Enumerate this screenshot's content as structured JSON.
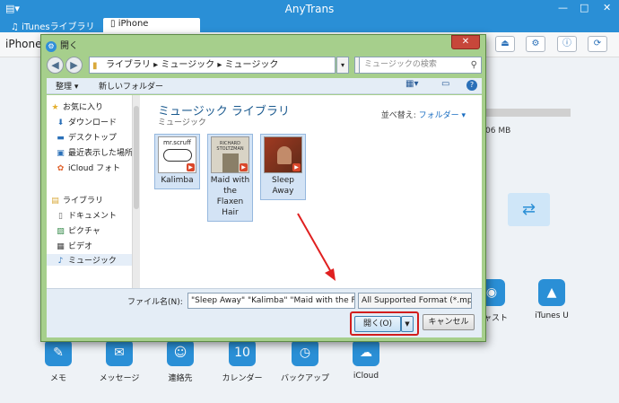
{
  "app": {
    "title": "AnyTrans",
    "menu_icon": "▤▾",
    "window_controls": [
      "—",
      "□",
      "✕"
    ],
    "tabs": [
      {
        "label": "iTunesライブラリ",
        "icon": "music-note-icon"
      },
      {
        "label": "iPhone",
        "icon": "phone-icon"
      }
    ],
    "device_name": "iPhone",
    "toolbar_icons": [
      "eject-icon",
      "gear-icon",
      "info-icon",
      "sync-icon"
    ],
    "storage_text": "06 MB",
    "apps_row1": [
      {
        "label": "キャスト",
        "icon": "podcast-icon"
      },
      {
        "label": "iTunes U",
        "icon": "graduation-cap-icon"
      }
    ],
    "apps_row2": [
      {
        "label": "メモ",
        "icon": "notes-icon"
      },
      {
        "label": "メッセージ",
        "icon": "message-icon"
      },
      {
        "label": "連絡先",
        "icon": "contacts-icon"
      },
      {
        "label": "カレンダー",
        "icon": "calendar-icon"
      },
      {
        "label": "バックアップ",
        "icon": "backup-icon"
      },
      {
        "label": "iCloud",
        "icon": "cloud-icon"
      }
    ],
    "calendar_day": "10"
  },
  "dialog": {
    "title": "開く",
    "close_icon": "✕",
    "address_path": "ライブラリ ▸ ミュージック ▸ ミュージック",
    "search_placeholder": "ミュージックの検索",
    "organize_label": "整理 ▾",
    "new_folder_label": "新しいフォルダー",
    "nav_items": [
      {
        "label": "お気に入り",
        "icon": "star-icon",
        "glyph": "★"
      },
      {
        "label": "ダウンロード",
        "icon": "download-icon",
        "glyph": "⬇"
      },
      {
        "label": "デスクトップ",
        "icon": "desktop-icon",
        "glyph": "▬"
      },
      {
        "label": "最近表示した場所",
        "icon": "recent-places-icon",
        "glyph": "▣"
      },
      {
        "label": "iCloud フォト",
        "icon": "icloud-photos-icon",
        "glyph": "✿"
      },
      {
        "label": "ライブラリ",
        "icon": "library-icon",
        "glyph": "▤"
      },
      {
        "label": "ドキュメント",
        "icon": "documents-icon",
        "glyph": "▯"
      },
      {
        "label": "ピクチャ",
        "icon": "pictures-icon",
        "glyph": "▨"
      },
      {
        "label": "ビデオ",
        "icon": "videos-icon",
        "glyph": "▦"
      },
      {
        "label": "ミュージック",
        "icon": "music-icon",
        "glyph": "♪"
      }
    ],
    "library_title": "ミュージック ライブラリ",
    "library_subtitle": "ミュージック",
    "arrange_label": "並べ替え:",
    "arrange_value": "フォルダー ▾",
    "files": [
      {
        "name": "Kalimba",
        "art": "mr.scruff"
      },
      {
        "name": "Maid with the Flaxen Hair",
        "art": "RICHARD STOLTZMAN"
      },
      {
        "name": "Sleep Away",
        "art": ""
      }
    ],
    "filename_label": "ファイル名(N):",
    "filename_value": "\"Sleep Away\" \"Kalimba\" \"Maid with the Fl",
    "filetype_value": "All Supported Format (*.mp",
    "open_label": "開く(O)",
    "cancel_label": "キャンセル",
    "highlight_color": "#d21d1d"
  }
}
